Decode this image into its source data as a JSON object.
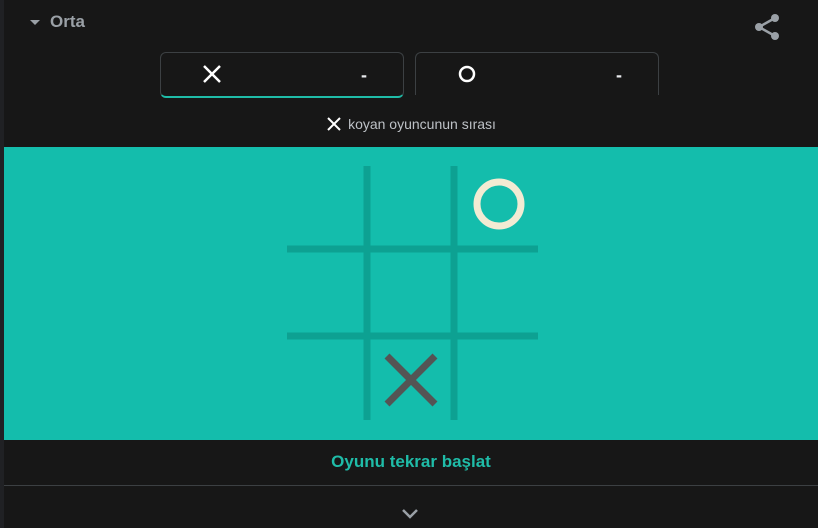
{
  "header": {
    "difficulty_label": "Orta",
    "caret_icon": "caret-down-icon",
    "share_icon": "share-icon"
  },
  "players": [
    {
      "symbol": "X",
      "score": "-",
      "active": true
    },
    {
      "symbol": "O",
      "score": "-",
      "active": false
    }
  ],
  "turn": {
    "symbol": "X",
    "text": "koyan oyuncunun sırası"
  },
  "board": {
    "cells": [
      "",
      "",
      "O",
      "",
      "",
      "",
      "",
      "X",
      ""
    ]
  },
  "restart_label": "Oyunu tekrar başlat",
  "expand_icon": "chevron-down-icon",
  "colors": {
    "board_bg": "#14bdac",
    "grid_line": "#0da192",
    "x_mark": "#545454",
    "o_mark": "#f2ebd3",
    "accent": "#1fbca8"
  }
}
